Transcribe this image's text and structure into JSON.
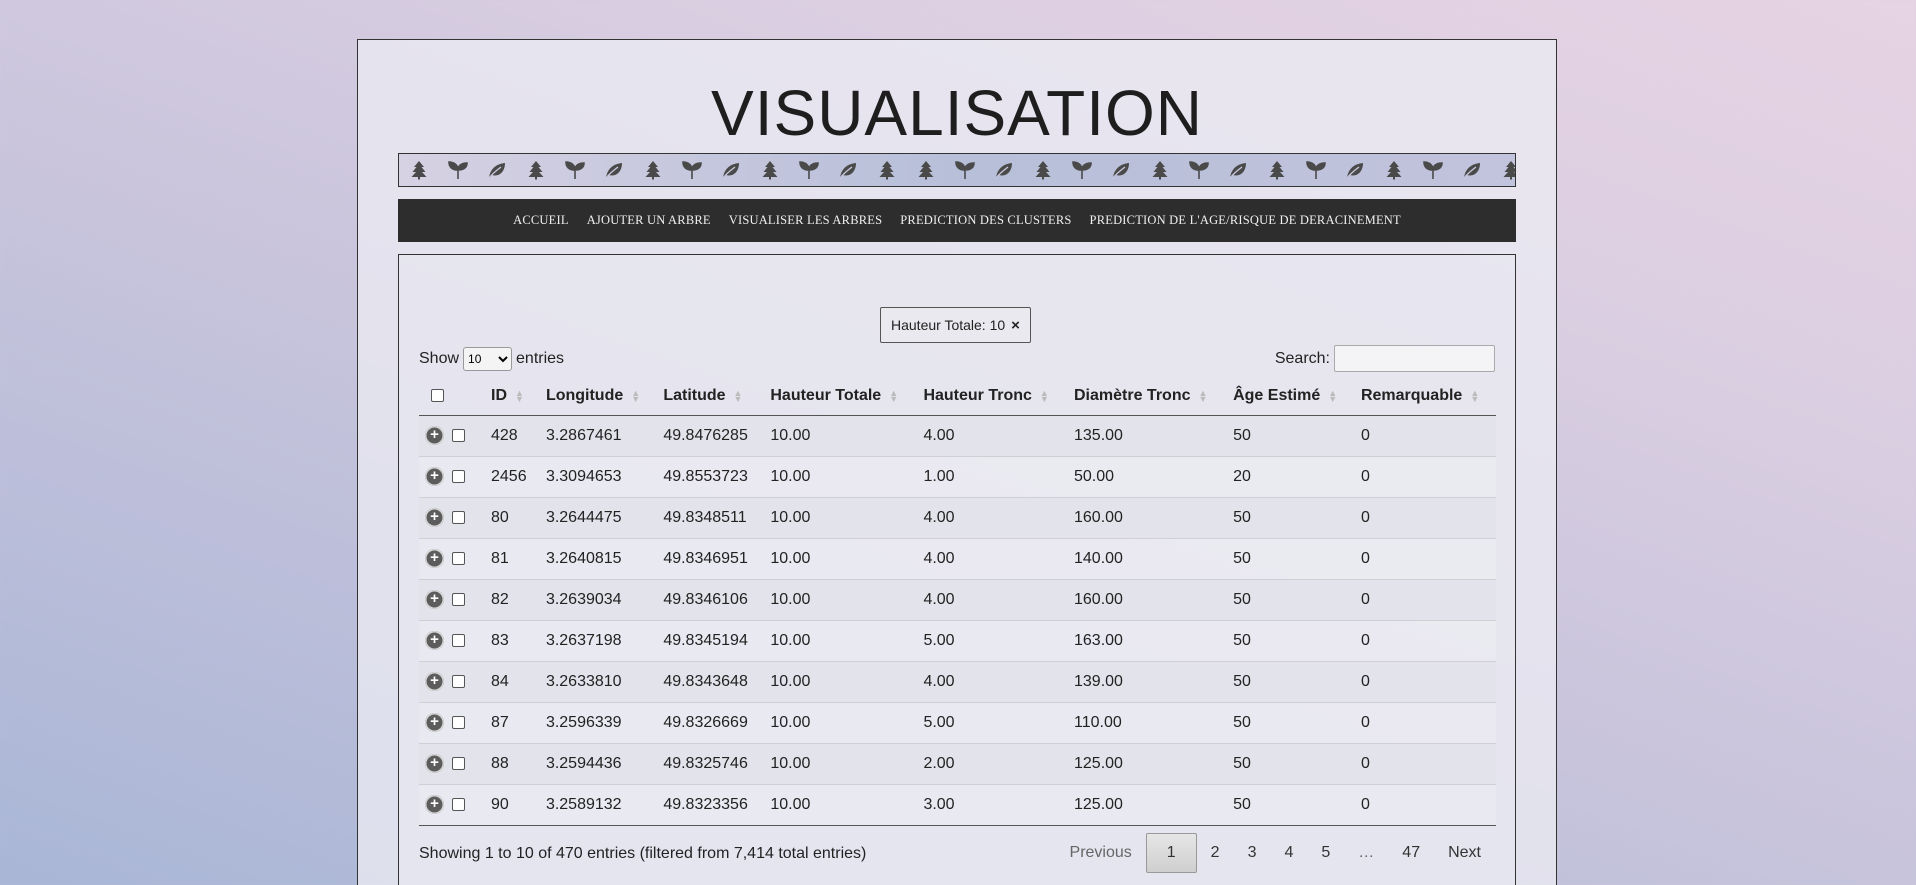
{
  "page": {
    "title": "VISUALISATION"
  },
  "icon_strip": {
    "icons": [
      "tree-icon",
      "sprout-icon",
      "leaf-icon",
      "tree-icon",
      "sprout-icon",
      "leaf-icon",
      "tree-icon",
      "sprout-icon",
      "leaf-icon",
      "tree-icon",
      "sprout-icon",
      "leaf-icon",
      "tree-icon",
      "tree-icon",
      "sprout-icon",
      "leaf-icon",
      "tree-icon",
      "sprout-icon",
      "leaf-icon",
      "tree-icon",
      "sprout-icon",
      "leaf-icon",
      "tree-icon",
      "sprout-icon",
      "leaf-icon",
      "tree-icon",
      "sprout-icon",
      "leaf-icon",
      "tree-icon"
    ]
  },
  "nav": {
    "items": [
      "ACCUEIL",
      "AJOUTER UN ARBRE",
      "VISUALISER LES ARBRES",
      "PREDICTION DES CLUSTERS",
      "PREDICTION DE L'AGE/RISQUE DE DERACINEMENT"
    ]
  },
  "filter": {
    "label": "Hauteur Totale: 10",
    "close": "×"
  },
  "length": {
    "prefix": "Show",
    "value": "10",
    "suffix": "entries"
  },
  "search": {
    "label": "Search:",
    "value": ""
  },
  "table": {
    "columns": [
      "ID",
      "Longitude",
      "Latitude",
      "Hauteur Totale",
      "Hauteur Tronc",
      "Diamètre Tronc",
      "Âge Estimé",
      "Remarquable"
    ],
    "rows": [
      [
        "428",
        "3.2867461",
        "49.8476285",
        "10.00",
        "4.00",
        "135.00",
        "50",
        "0"
      ],
      [
        "2456",
        "3.3094653",
        "49.8553723",
        "10.00",
        "1.00",
        "50.00",
        "20",
        "0"
      ],
      [
        "80",
        "3.2644475",
        "49.8348511",
        "10.00",
        "4.00",
        "160.00",
        "50",
        "0"
      ],
      [
        "81",
        "3.2640815",
        "49.8346951",
        "10.00",
        "4.00",
        "140.00",
        "50",
        "0"
      ],
      [
        "82",
        "3.2639034",
        "49.8346106",
        "10.00",
        "4.00",
        "160.00",
        "50",
        "0"
      ],
      [
        "83",
        "3.2637198",
        "49.8345194",
        "10.00",
        "5.00",
        "163.00",
        "50",
        "0"
      ],
      [
        "84",
        "3.2633810",
        "49.8343648",
        "10.00",
        "4.00",
        "139.00",
        "50",
        "0"
      ],
      [
        "87",
        "3.2596339",
        "49.8326669",
        "10.00",
        "5.00",
        "110.00",
        "50",
        "0"
      ],
      [
        "88",
        "3.2594436",
        "49.8325746",
        "10.00",
        "2.00",
        "125.00",
        "50",
        "0"
      ],
      [
        "90",
        "3.2589132",
        "49.8323356",
        "10.00",
        "3.00",
        "125.00",
        "50",
        "0"
      ]
    ]
  },
  "info": "Showing 1 to 10 of 470 entries (filtered from 7,414 total entries)",
  "pagination": {
    "previous": "Previous",
    "pages": [
      "1",
      "2",
      "3",
      "4",
      "5",
      "…",
      "47"
    ],
    "current": "1",
    "next": "Next"
  }
}
